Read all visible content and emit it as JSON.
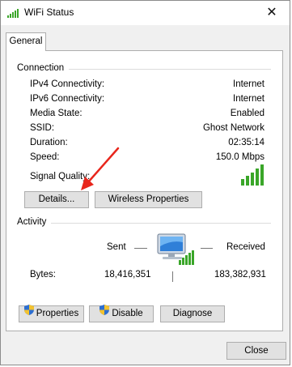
{
  "window": {
    "title": "WiFi Status",
    "close_glyph": "✕"
  },
  "tabs": [
    {
      "label": "General"
    }
  ],
  "connection": {
    "heading": "Connection",
    "rows": [
      {
        "label": "IPv4 Connectivity:",
        "value": "Internet"
      },
      {
        "label": "IPv6 Connectivity:",
        "value": "Internet"
      },
      {
        "label": "Media State:",
        "value": "Enabled"
      },
      {
        "label": "SSID:",
        "value": "Ghost Network"
      },
      {
        "label": "Duration:",
        "value": "02:35:14"
      },
      {
        "label": "Speed:",
        "value": "150.0 Mbps"
      }
    ],
    "signal_quality_label": "Signal Quality:",
    "signal_bars_lit": 5,
    "signal_bars_total": 5,
    "details_button": "Details...",
    "wireless_properties_button": "Wireless Properties"
  },
  "activity": {
    "heading": "Activity",
    "sent_label": "Sent",
    "received_label": "Received",
    "bytes_label": "Bytes:",
    "bytes_sent": "18,416,351",
    "bytes_received": "183,382,931"
  },
  "actions": {
    "properties_button": "Properties",
    "disable_button": "Disable",
    "diagnose_button": "Diagnose"
  },
  "footer": {
    "close_button": "Close"
  },
  "icons": {
    "title": "wifi-signal-icon",
    "shield": "uac-shield-icon",
    "network": "network-computer-icon",
    "annotation": "red-arrow-annotation"
  },
  "colors": {
    "signal_green": "#3aa629",
    "annotation_red": "#e8261c",
    "button_bg": "#e1e1e1"
  }
}
